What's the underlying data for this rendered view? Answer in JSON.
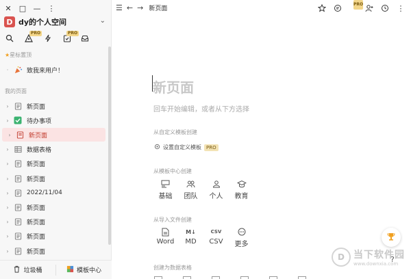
{
  "window": {
    "close_glyph": "✕",
    "max_glyph": "□",
    "min_glyph": "—",
    "more_glyph": "⋮"
  },
  "workspace": {
    "logo_letter": "D",
    "name": "dy的个人空间",
    "chevron": "⌄"
  },
  "toolbar_pro": "PRO",
  "sidebar": {
    "starred_label": "星标置顶",
    "starred_items": [
      {
        "label": "致我来用户！",
        "icon": "party-icon"
      }
    ],
    "my_pages_label": "我的页面",
    "pages": [
      {
        "label": "新页面",
        "icon": "page-icon",
        "expandable": true,
        "active": false
      },
      {
        "label": "待办事项",
        "icon": "checkbox-icon",
        "expandable": true,
        "active": false
      },
      {
        "label": "新页面",
        "icon": "page-icon",
        "expandable": true,
        "active": true
      },
      {
        "label": "数据表格",
        "icon": "table-icon",
        "expandable": true,
        "active": false
      },
      {
        "label": "新页面",
        "icon": "page-icon",
        "expandable": true,
        "active": false
      },
      {
        "label": "新页面",
        "icon": "page-icon",
        "expandable": true,
        "active": false
      },
      {
        "label": "2022/11/04",
        "icon": "page-icon",
        "expandable": true,
        "active": false
      },
      {
        "label": "新页面",
        "icon": "page-icon",
        "expandable": true,
        "active": false
      },
      {
        "label": "新页面",
        "icon": "page-icon",
        "expandable": true,
        "active": false
      },
      {
        "label": "新页面",
        "icon": "page-icon",
        "expandable": true,
        "active": false
      },
      {
        "label": "新页面",
        "icon": "page-icon",
        "expandable": true,
        "active": false
      }
    ],
    "footer": {
      "trash_label": "垃圾桶",
      "templates_label": "模板中心"
    }
  },
  "topbar": {
    "breadcrumb": "新页面",
    "pro": "PRO"
  },
  "editor": {
    "title_placeholder": "新页面",
    "hint": "回车开始编辑，或者从下方选择",
    "custom_tpl_heading": "从自定义模板创建",
    "custom_tpl_link": "设置自定义模板",
    "custom_tpl_pro": "PRO",
    "center_heading": "从模板中心创建",
    "center_items": [
      {
        "label": "基础",
        "icon": "layout-icon"
      },
      {
        "label": "团队",
        "icon": "team-icon"
      },
      {
        "label": "个人",
        "icon": "person-icon"
      },
      {
        "label": "教育",
        "icon": "education-icon"
      }
    ],
    "import_heading": "从导入文件创建",
    "import_items": [
      {
        "label": "Word",
        "icon": "word-icon"
      },
      {
        "label": "MD",
        "icon": "markdown-icon"
      },
      {
        "label": "CSV",
        "icon": "csv-icon"
      },
      {
        "label": "更多",
        "icon": "more-icon"
      }
    ],
    "db_heading": "创建为数据表格"
  },
  "help": "?",
  "watermark": {
    "logo": "D",
    "name": "当下软件园",
    "url": "www.downxia.com"
  },
  "colors": {
    "accent": "#d9534f",
    "active_bg": "#fbe3e3",
    "pro_bg": "#f3d68a"
  }
}
